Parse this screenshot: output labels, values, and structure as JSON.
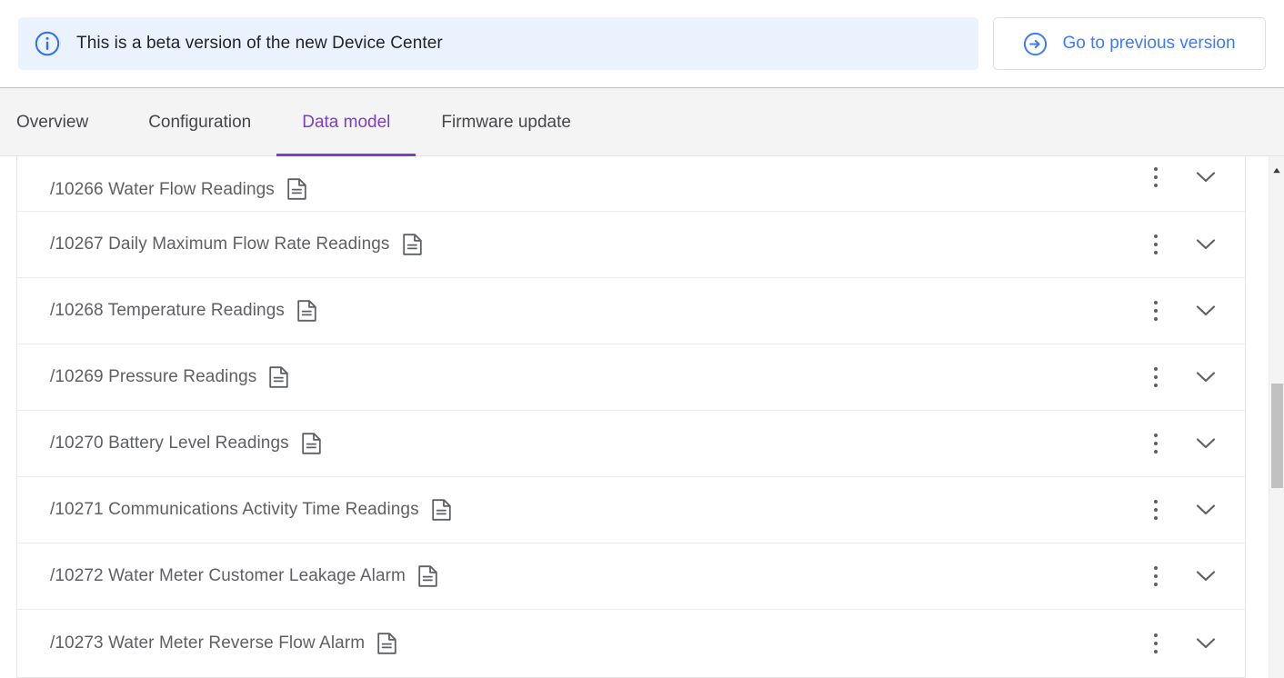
{
  "banner": {
    "icon": "info-circle-icon",
    "message": "This is a beta version of the new Device Center",
    "action": {
      "icon": "arrow-right-circle-icon",
      "label": "Go to previous version"
    },
    "background_color": "#eaf2fd",
    "link_color": "#3d7bfb"
  },
  "tabs": {
    "accent_color": "#7d3fc0",
    "items": [
      {
        "label": "Overview",
        "active": false
      },
      {
        "label": "Configuration",
        "active": false
      },
      {
        "label": "Data model",
        "active": true
      },
      {
        "label": "Firmware update",
        "active": false
      }
    ]
  },
  "data_model_list": {
    "row_icon": "document-icon",
    "menu_icon": "kebab-menu-icon",
    "expand_icon": "chevron-down-icon",
    "rows": [
      {
        "label": "/10266 Water Flow Readings"
      },
      {
        "label": "/10267 Daily Maximum Flow Rate Readings"
      },
      {
        "label": "/10268 Temperature Readings"
      },
      {
        "label": "/10269 Pressure Readings"
      },
      {
        "label": "/10270 Battery Level Readings"
      },
      {
        "label": "/10271 Communications Activity Time Readings"
      },
      {
        "label": "/10272 Water Meter Customer Leakage Alarm"
      },
      {
        "label": "/10273 Water Meter Reverse Flow Alarm"
      }
    ]
  },
  "scrollbar": {
    "up_arrow_icon": "scroll-up-arrow-icon",
    "thumb_color": "#c1c1c1"
  }
}
